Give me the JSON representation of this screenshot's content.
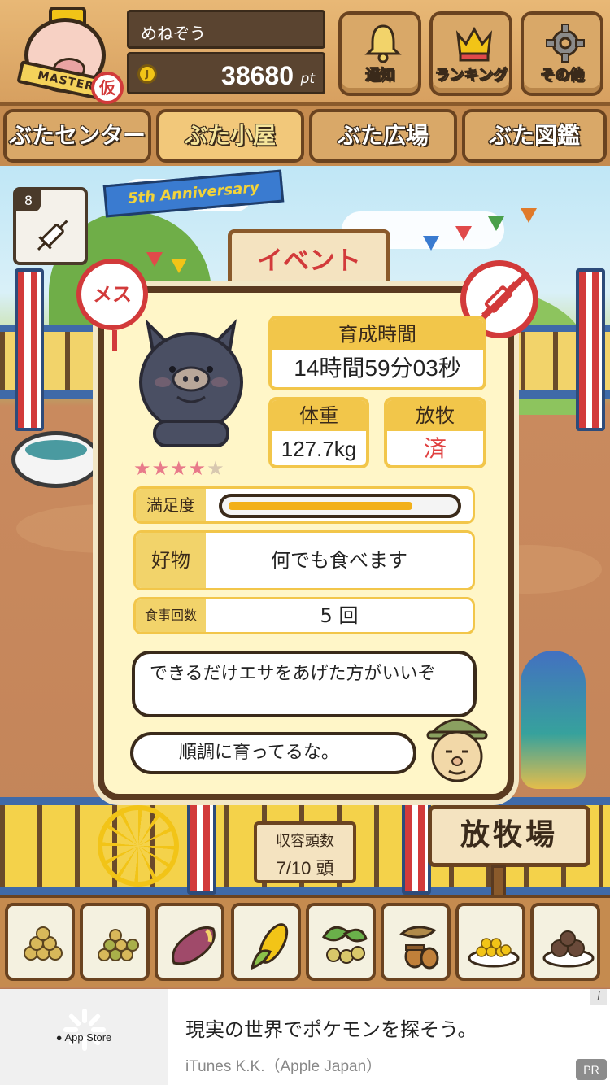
{
  "header": {
    "player_name": "めねぞう",
    "points": "38680",
    "points_unit": "pt",
    "coin_symbol": "J",
    "master_label": "MASTER",
    "provisional_badge": "仮",
    "buttons": [
      {
        "label": "通知",
        "icon": "bell-icon"
      },
      {
        "label": "ランキング",
        "icon": "crown-icon"
      },
      {
        "label": "その他",
        "icon": "gear-icon"
      }
    ]
  },
  "tabs": [
    {
      "label": "ぶたセンター",
      "active": false
    },
    {
      "label": "ぶた小屋",
      "active": true
    },
    {
      "label": "ぶた広場",
      "active": false
    },
    {
      "label": "ぶた図鑑",
      "active": false
    }
  ],
  "scene": {
    "syringe_count": "8",
    "anniversary_banner": "5th Anniversary",
    "event_sign": "イベント"
  },
  "pig": {
    "gender_label": "メス",
    "rating": 4,
    "rating_max": 5,
    "raising_time_label": "育成時間",
    "raising_time": "14時間59分03秒",
    "weight_label": "体重",
    "weight": "127.7kg",
    "grazing_label": "放牧",
    "grazing_status": "済",
    "satisfaction_label": "満足度",
    "satisfaction_level": 0.85,
    "favorite_label": "好物",
    "favorite": "何でも食べます",
    "meals_label": "食事回数",
    "meals": "5 回"
  },
  "dialogue": {
    "advice": "できるだけエサをあげた方がいいぞ",
    "comment": "順調に育ってるな。"
  },
  "pasture": {
    "sign": "放牧場",
    "capacity_label": "収容頭数",
    "capacity_value": "7/10 頭"
  },
  "food_items": [
    {
      "icon": "soybeans-icon"
    },
    {
      "icon": "mixed-beans-icon"
    },
    {
      "icon": "sweet-potato-icon"
    },
    {
      "icon": "corn-icon"
    },
    {
      "icon": "leafy-nuts-icon"
    },
    {
      "icon": "acorn-icon"
    },
    {
      "icon": "grain-plate-icon"
    },
    {
      "icon": "meatball-plate-icon"
    }
  ],
  "ad": {
    "store_label": "App Store",
    "title": "現実の世界でポケモンを探そう。",
    "advertiser": "iTunes K.K.（Apple Japan）",
    "info_icon": "i",
    "pr_label": "PR"
  },
  "colors": {
    "accent_yellow": "#f2c64a",
    "wood": "#d9a868",
    "alert_red": "#d23a3a",
    "panel_bg": "#fff6c8"
  }
}
